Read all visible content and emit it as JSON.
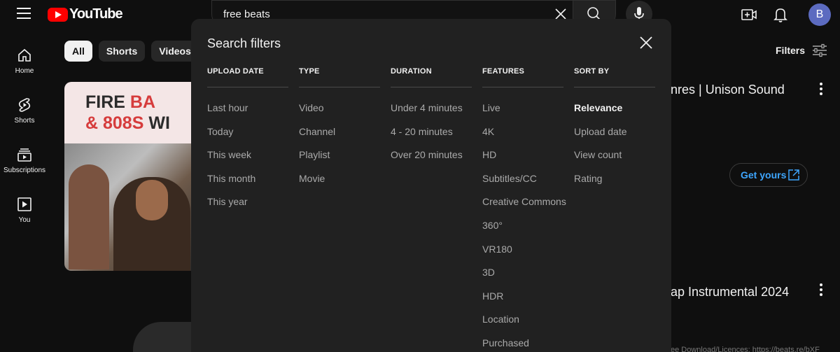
{
  "header": {
    "logo_text": "YouTube",
    "search_value": "free beats",
    "avatar_letter": "B"
  },
  "sidebar": {
    "items": [
      {
        "label": "Home",
        "icon": "home-icon"
      },
      {
        "label": "Shorts",
        "icon": "shorts-icon"
      },
      {
        "label": "Subscriptions",
        "icon": "subscriptions-icon"
      },
      {
        "label": "You",
        "icon": "you-icon"
      }
    ]
  },
  "chips": [
    "All",
    "Shorts",
    "Videos"
  ],
  "filters_label": "Filters",
  "background": {
    "thumb_line1_a": "FIRE ",
    "thumb_line1_b": "BA",
    "thumb_line2_a": "& 808S ",
    "thumb_line2_b": "WI",
    "video1_title": "nres | Unison Sound",
    "video2_title": "ap Instrumental 2024",
    "get_yours_label": "Get yours",
    "desc_tail": "ee Download/Licences: https://beats.re/bXF"
  },
  "modal": {
    "title": "Search filters",
    "columns": [
      {
        "heading": "UPLOAD DATE",
        "options": [
          "Last hour",
          "Today",
          "This week",
          "This month",
          "This year"
        ]
      },
      {
        "heading": "TYPE",
        "options": [
          "Video",
          "Channel",
          "Playlist",
          "Movie"
        ]
      },
      {
        "heading": "DURATION",
        "options": [
          "Under 4 minutes",
          "4 - 20 minutes",
          "Over 20 minutes"
        ]
      },
      {
        "heading": "FEATURES",
        "options": [
          "Live",
          "4K",
          "HD",
          "Subtitles/CC",
          "Creative Commons",
          "360°",
          "VR180",
          "3D",
          "HDR",
          "Location",
          "Purchased"
        ]
      },
      {
        "heading": "SORT BY",
        "options": [
          "Relevance",
          "Upload date",
          "View count",
          "Rating"
        ]
      }
    ],
    "selected_sort": "Relevance"
  },
  "colors": {
    "background": "#0f0f0f",
    "modal": "#212121",
    "brand_red": "#ff0000",
    "link_blue": "#3ea6ff"
  }
}
